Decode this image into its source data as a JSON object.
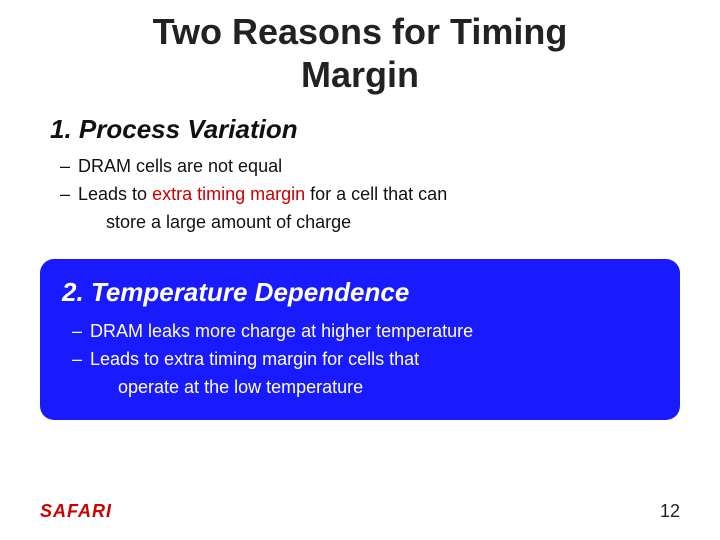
{
  "title": {
    "line1": "Two Reasons for Timing",
    "line2": "Margin"
  },
  "section1": {
    "heading_num": "1.",
    "heading_text": "Process Variation",
    "bullets": [
      {
        "text_plain": "DRAM cells are not equal",
        "highlight": null
      },
      {
        "text_plain": "Leads to ",
        "highlight_text": "extra timing margin",
        "text_after": " for a cell that can store a large amount of charge"
      }
    ]
  },
  "section2": {
    "heading_num": "2.",
    "heading_text": "Temperature Dependence",
    "bullets": [
      {
        "text": "DRAM leaks more charge at higher temperature"
      },
      {
        "text": "Leads to extra timing margin for cells that operate at the low temperature"
      }
    ]
  },
  "footer": {
    "logo": "SAFARI",
    "page_number": "12"
  }
}
